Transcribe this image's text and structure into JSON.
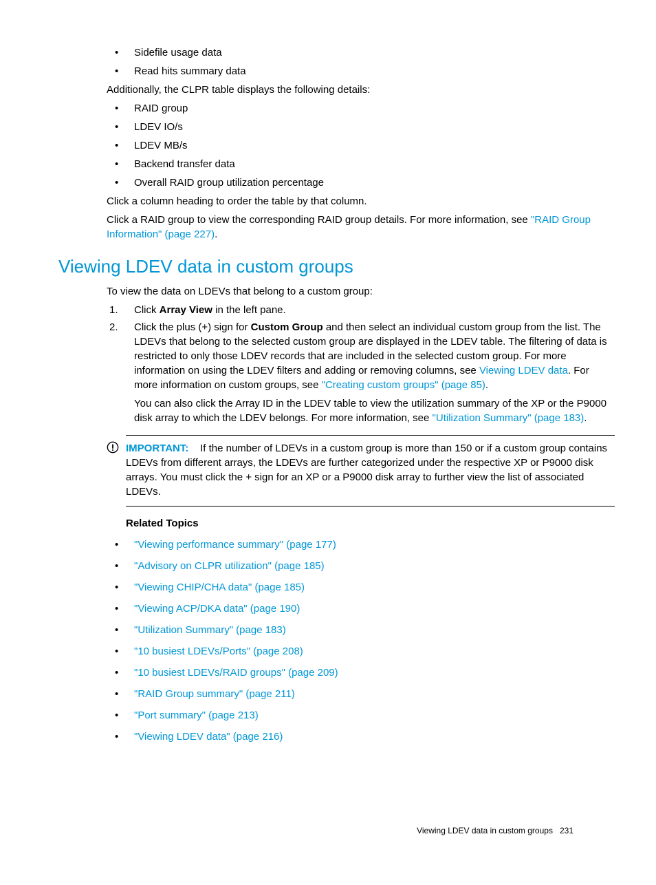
{
  "top_bullets": [
    "Sidefile usage data",
    "Read hits summary data"
  ],
  "additional_intro": "Additionally, the CLPR table displays the following details:",
  "details_bullets": [
    "RAID group",
    "LDEV IO/s",
    "LDEV MB/s",
    "Backend transfer data",
    "Overall RAID group utilization percentage"
  ],
  "click_column": "Click a column heading to order the table by that column.",
  "click_raid_pre": "Click a RAID group to view the corresponding RAID group details. For more information, see ",
  "raid_group_link": "\"RAID Group Information\" (page 227)",
  "period": ".",
  "heading": "Viewing LDEV data in custom groups",
  "intro_line": "To view the data on LDEVs that belong to a custom group:",
  "step1_num": "1.",
  "step1_pre": "Click ",
  "step1_bold": "Array View",
  "step1_post": " in the left pane.",
  "step2_num": "2.",
  "step2_pre": "Click the plus (+) sign for ",
  "step2_bold": "Custom Group",
  "step2_post1": " and then select an individual custom group from the list. The LDEVs that belong to the selected custom group are displayed in the LDEV table. The filtering of data is restricted to only those LDEV records that are included in the selected custom group. For more information on using the LDEV filters and adding or removing columns, see ",
  "step2_link1": "Viewing LDEV data",
  "step2_post2": ". For more information on custom groups, see ",
  "step2_link2": "\"Creating custom groups\" (page 85)",
  "step2_sub_pre": "You can also click the Array ID in the LDEV table to view the utilization summary of the XP or the P9000 disk array to which the LDEV belongs. For more information, see ",
  "step2_sub_link": "\"Utilization Summary\" (page 183)",
  "imp_label": "IMPORTANT:",
  "imp_text": " If the number of LDEVs in a custom group is more than 150 or if a custom group contains LDEVs from different arrays, the LDEVs are further categorized under the respective XP or P9000 disk arrays. You must click the + sign for an XP or a P9000 disk array to further view the list of associated LDEVs.",
  "related_heading": "Related Topics",
  "related_links": [
    "\"Viewing performance summary\" (page 177)",
    "\"Advisory on CLPR utilization\" (page 185)",
    "\"Viewing CHIP/CHA data\" (page 185)",
    "\"Viewing ACP/DKA data\" (page 190)",
    "\"Utilization Summary\" (page 183)",
    "\"10 busiest LDEVs/Ports\" (page 208)",
    "\"10 busiest LDEVs/RAID groups\" (page 209)",
    "\"RAID Group summary\" (page 211)",
    "\"Port summary\" (page 213)",
    "\"Viewing LDEV data\" (page 216)"
  ],
  "footer_text": "Viewing LDEV data in custom groups",
  "footer_page": "231"
}
